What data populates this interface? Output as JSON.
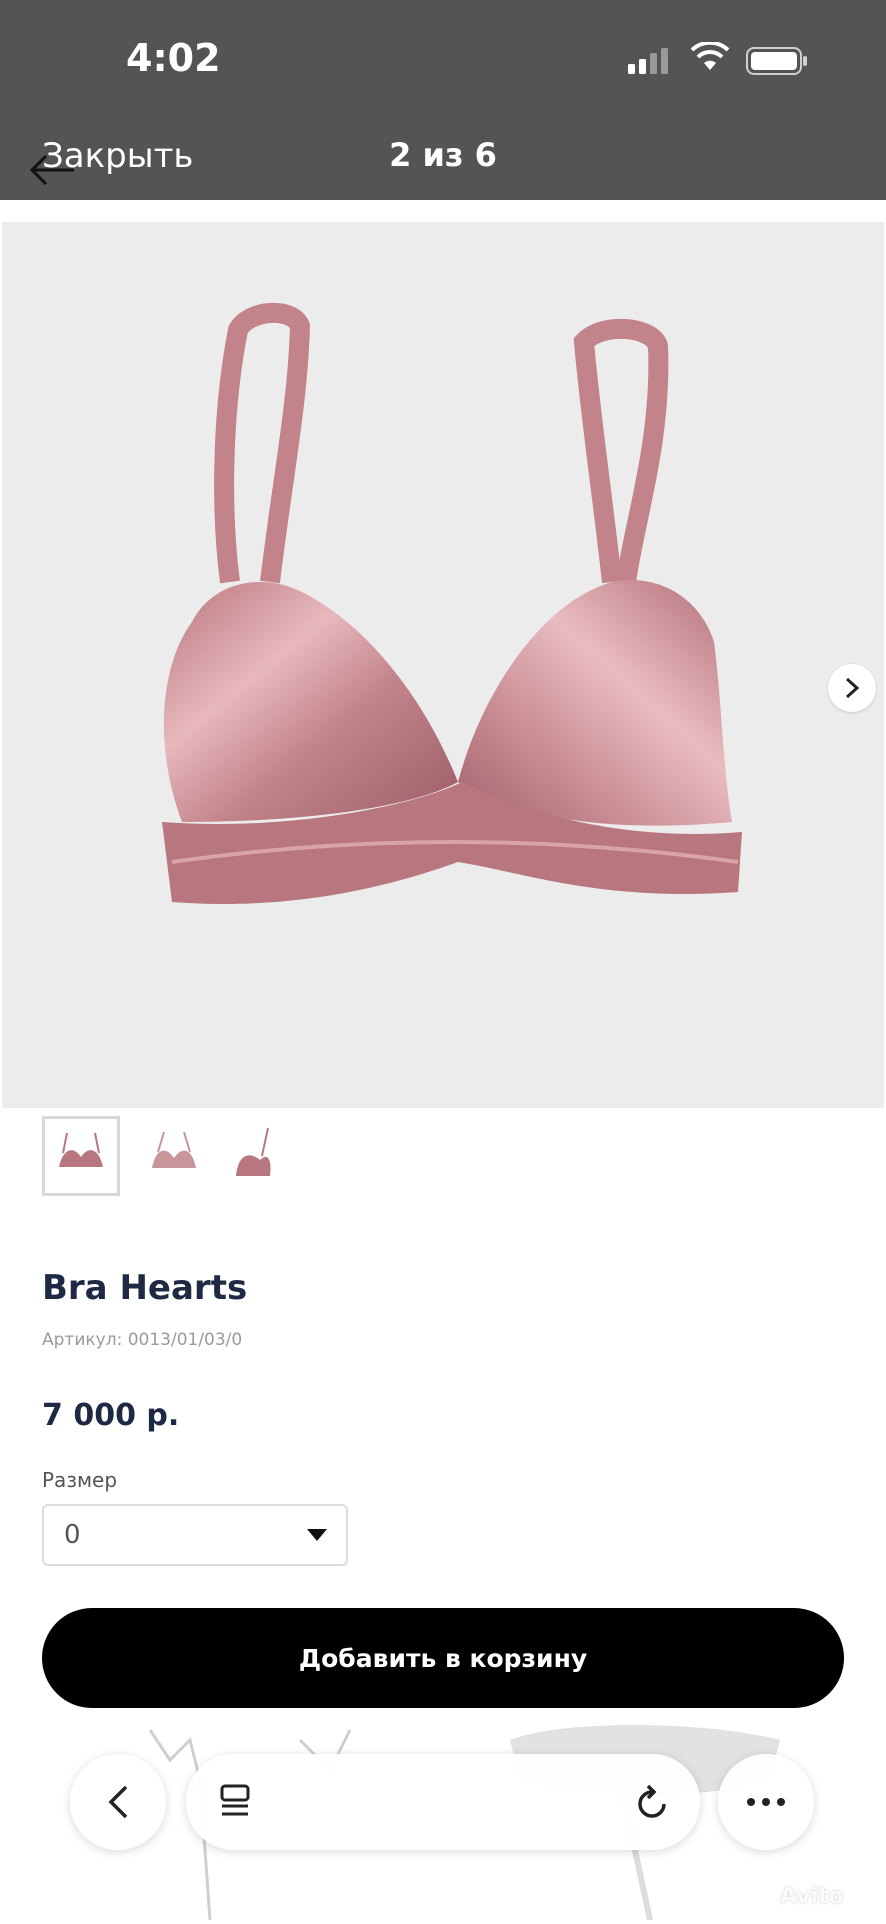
{
  "status_bar": {
    "time": "4:02"
  },
  "header": {
    "close_label": "Закрыть",
    "counter": "2 из 6"
  },
  "product": {
    "title": "Bra Hearts",
    "sku": "Артикул: 0013/01/03/0",
    "price": "7 000 р.",
    "size_label": "Размер",
    "size_value": "0",
    "add_to_cart": "Добавить в корзину"
  },
  "gallery": {
    "thumbnails": 3,
    "active_index": 0
  },
  "watermark": "Avito",
  "colors": {
    "header_bg": "#545454",
    "hero_bg": "#ececec",
    "product_pink": "#c88c92",
    "title_color": "#1e2a44",
    "button_bg": "#000000"
  }
}
